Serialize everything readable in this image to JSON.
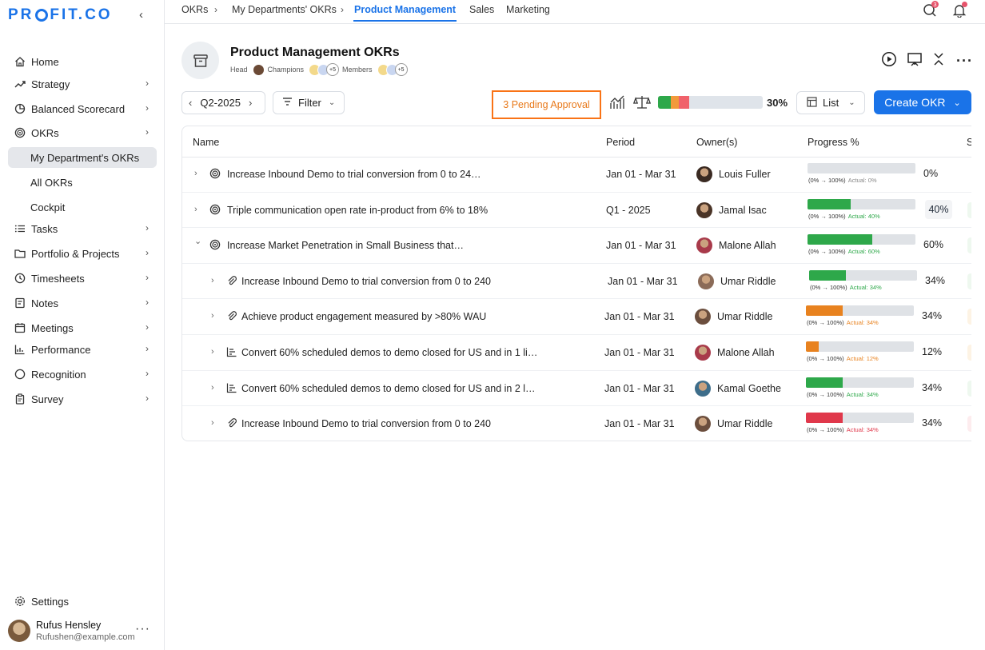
{
  "logo": {
    "pre": "PR",
    "post": "FIT.CO"
  },
  "sidebar": {
    "items": [
      {
        "label": "Home",
        "icon": "home-icon",
        "chevron": false
      },
      {
        "label": "Strategy",
        "icon": "trend-icon",
        "chevron": true
      },
      {
        "label": "Balanced Scorecard",
        "icon": "pie-icon",
        "chevron": true
      },
      {
        "label": "OKRs",
        "icon": "target-icon",
        "chevron": true
      },
      {
        "label": "My Department's OKRs",
        "icon": "",
        "chevron": false,
        "sub": true,
        "active": true
      },
      {
        "label": "All OKRs",
        "icon": "",
        "chevron": false,
        "sub": true
      },
      {
        "label": "Cockpit",
        "icon": "",
        "chevron": false,
        "sub": true
      },
      {
        "label": "Tasks",
        "icon": "list-icon",
        "chevron": true
      },
      {
        "label": "Portfolio & Projects",
        "icon": "folder-icon",
        "chevron": true
      },
      {
        "label": "Timesheets",
        "icon": "clock-icon",
        "chevron": true
      },
      {
        "label": "Notes",
        "icon": "note-icon",
        "chevron": true
      },
      {
        "label": "Meetings",
        "icon": "calendar-icon",
        "chevron": true
      },
      {
        "label": "Performance",
        "icon": "chart-icon",
        "chevron": true
      },
      {
        "label": "Recognition",
        "icon": "circle-icon",
        "chevron": true
      },
      {
        "label": "Survey",
        "icon": "clipboard-icon",
        "chevron": true
      }
    ],
    "settings_label": "Settings",
    "user": {
      "name": "Rufus Hensley",
      "email": "Rufushen@example.com"
    }
  },
  "breadcrumb": {
    "okrs": "OKRs",
    "my_departments": "My Departments' OKRs",
    "active": "Product Management",
    "sales": "Sales",
    "marketing": "Marketing"
  },
  "notifications": {
    "messages_count": "3"
  },
  "header": {
    "title": "Product Management OKRs",
    "head_label": "Head",
    "champions_label": "Champions",
    "champions_more": "+5",
    "members_label": "Members",
    "members_more": "+5"
  },
  "toolbar": {
    "period": "Q2-2025",
    "filter_label": "Filter",
    "pending_label": "3 Pending Approval",
    "overall_pct": "30%",
    "view_label": "List",
    "create_label": "Create OKR",
    "overall_segments": [
      {
        "fraction": 0.12,
        "color": "#2ea84a"
      },
      {
        "fraction": 0.08,
        "color": "#f29a3b"
      },
      {
        "fraction": 0.1,
        "color": "#f0626b"
      }
    ]
  },
  "table": {
    "columns": {
      "name": "Name",
      "period": "Period",
      "owners": "Owner(s)",
      "progress": "Progress %",
      "status_initial": "S"
    },
    "rows": [
      {
        "name": "Increase Inbound Demo to trial conversion from 0 to 24…",
        "period": "Jan 01 - Mar 31",
        "owner": "Louis Fuller",
        "progress": 0,
        "range": "(0% → 100%)",
        "actual": "Actual: 0%",
        "pct": "0%",
        "color": "#2ea84a",
        "actual_color": "#888888",
        "indent": 0,
        "expanded": false,
        "icon": "target-icon"
      },
      {
        "name": "Triple communication open rate in-product from 6% to 18%",
        "period": "Q1 - 2025",
        "owner": "Jamal Isac",
        "progress": 0.4,
        "range": "(0% → 100%)",
        "actual": "Actual: 40%",
        "pct": "40%",
        "color": "#2ea84a",
        "actual_color": "#2ea84a",
        "indent": 0,
        "expanded": false,
        "icon": "target-icon",
        "boxed": true
      },
      {
        "name": "Increase Market Penetration in Small Business that…",
        "period": "Jan 01 - Mar 31",
        "owner": "Malone Allah",
        "progress": 0.6,
        "range": "(0% → 100%)",
        "actual": "Actual: 60%",
        "pct": "60%",
        "color": "#2ea84a",
        "actual_color": "#2ea84a",
        "indent": 0,
        "expanded": true,
        "icon": "target-icon"
      },
      {
        "name": "Increase Inbound Demo to trial conversion from 0 to 240",
        "period": "Jan 01 - Mar 31",
        "owner": "Umar Riddle",
        "progress": 0.34,
        "range": "(0% → 100%)",
        "actual": "Actual: 34%",
        "pct": "34%",
        "color": "#2ea84a",
        "actual_color": "#2ea84a",
        "indent": 1,
        "expanded": false,
        "icon": "paperclip-icon"
      },
      {
        "name": "Achieve product engagement measured by >80% WAU",
        "period": "Jan 01 - Mar 31",
        "owner": "Umar Riddle",
        "progress": 0.34,
        "range": "(0% → 100%)",
        "actual": "Actual: 34%",
        "pct": "34%",
        "color": "#e8821f",
        "actual_color": "#e8821f",
        "indent": 1,
        "expanded": false,
        "icon": "paperclip-icon"
      },
      {
        "name": "Convert 60% scheduled demos to demo closed for US  and in 1 li…",
        "period": "Jan 01 - Mar 31",
        "owner": "Malone Allah",
        "progress": 0.12,
        "range": "(0% → 100%)",
        "actual": "Actual: 12%",
        "pct": "12%",
        "color": "#e8821f",
        "actual_color": "#e8821f",
        "indent": 1,
        "expanded": false,
        "icon": "bar-chart-icon"
      },
      {
        "name": "Convert 60% scheduled demos to demo closed for US  and in 2 l…",
        "period": "Jan 01 - Mar 31",
        "owner": "Kamal Goethe",
        "progress": 0.34,
        "range": "(0% → 100%)",
        "actual": "Actual: 34%",
        "pct": "34%",
        "color": "#2ea84a",
        "actual_color": "#2ea84a",
        "indent": 1,
        "expanded": false,
        "icon": "bar-chart-icon"
      },
      {
        "name": "Increase Inbound Demo to trial conversion from 0 to 240",
        "period": "Jan 01 - Mar 31",
        "owner": "Umar Riddle",
        "progress": 0.34,
        "range": "(0% → 100%)",
        "actual": "Actual: 34%",
        "pct": "34%",
        "color": "#e0384b",
        "actual_color": "#e0384b",
        "indent": 1,
        "expanded": false,
        "icon": "paperclip-icon"
      }
    ]
  }
}
